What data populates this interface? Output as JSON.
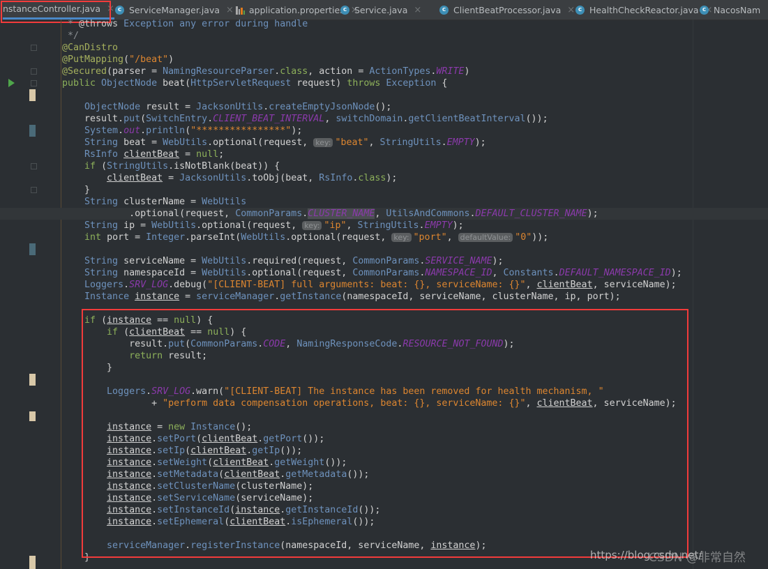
{
  "tabs": [
    {
      "label": "nstanceController.java",
      "icon": "none",
      "active": true
    },
    {
      "label": "ServiceManager.java",
      "icon": "class-icon"
    },
    {
      "label": "application.properties",
      "icon": "properties-icon"
    },
    {
      "label": "Service.java",
      "icon": "class-icon"
    },
    {
      "label": "ClientBeatProcessor.java",
      "icon": "class-icon"
    },
    {
      "label": "HealthCheckReactor.java",
      "icon": "class-icon"
    },
    {
      "label": "NacosNam",
      "icon": "class-icon"
    }
  ],
  "tab_close_glyph": "×",
  "class_icon_letter": "c",
  "colors": {
    "highlight_box": "#f23b3b",
    "keyword": "#8db05a",
    "type": "#6e92bd",
    "string": "#dd8630",
    "constant": "#8b3aab",
    "annotation": "#a6b15d",
    "background": "#2b2f33"
  },
  "code_lines": [
    {
      "indent": 0,
      "tokens": [
        [
          " * ",
          "c"
        ],
        [
          "@throws",
          "cd"
        ],
        [
          " Exception any error during handle",
          "t"
        ]
      ]
    },
    {
      "indent": 0,
      "tokens": [
        [
          " */",
          "c"
        ]
      ]
    },
    {
      "indent": 0,
      "tokens": [
        [
          "@CanDistro",
          "a"
        ]
      ]
    },
    {
      "indent": 0,
      "tokens": [
        [
          "@PutMapping",
          "a"
        ],
        [
          "(",
          ""
        ],
        [
          "\"/beat\"",
          "s"
        ],
        [
          ")",
          ""
        ]
      ]
    },
    {
      "indent": 0,
      "tokens": [
        [
          "@Secured",
          "a"
        ],
        [
          "(parser = ",
          ""
        ],
        [
          "NamingResourceParser",
          "t"
        ],
        [
          ".",
          ""
        ],
        [
          "class",
          "k"
        ],
        [
          ", action = ",
          ""
        ],
        [
          "ActionTypes",
          "t"
        ],
        [
          ".",
          ""
        ],
        [
          "WRITE",
          "p"
        ],
        [
          ")",
          ""
        ]
      ]
    },
    {
      "indent": 0,
      "tokens": [
        [
          "public ",
          "k"
        ],
        [
          "ObjectNode ",
          "t"
        ],
        [
          "beat(",
          ""
        ],
        [
          "HttpServletRequest ",
          "t"
        ],
        [
          "request) ",
          ""
        ],
        [
          "throws ",
          "k"
        ],
        [
          "Exception ",
          "t"
        ],
        [
          "{",
          ""
        ]
      ]
    },
    {
      "indent": 0,
      "tokens": []
    },
    {
      "indent": 4,
      "tokens": [
        [
          "ObjectNode ",
          "t"
        ],
        [
          "result = ",
          ""
        ],
        [
          "JacksonUtils",
          "t"
        ],
        [
          ".",
          ""
        ],
        [
          "createEmptyJsonNode",
          "t"
        ],
        [
          "();",
          ""
        ]
      ]
    },
    {
      "indent": 4,
      "tokens": [
        [
          "result.",
          ""
        ],
        [
          "put",
          "t"
        ],
        [
          "(",
          ""
        ],
        [
          "SwitchEntry",
          "t"
        ],
        [
          ".",
          ""
        ],
        [
          "CLIENT_BEAT_INTERVAL",
          "p"
        ],
        [
          ", ",
          ""
        ],
        [
          "switchDomain",
          "t"
        ],
        [
          ".",
          ""
        ],
        [
          "getClientBeatInterval",
          "t"
        ],
        [
          "());",
          ""
        ]
      ]
    },
    {
      "indent": 4,
      "tokens": [
        [
          "System",
          "t"
        ],
        [
          ".",
          ""
        ],
        [
          "out",
          "p"
        ],
        [
          ".",
          ""
        ],
        [
          "println",
          "t"
        ],
        [
          "(",
          ""
        ],
        [
          "\"****************\"",
          "s"
        ],
        [
          ");",
          ""
        ]
      ]
    },
    {
      "indent": 4,
      "tokens": [
        [
          "String ",
          "t"
        ],
        [
          "beat = ",
          ""
        ],
        [
          "WebUtils",
          "t"
        ],
        [
          ".optional(request, ",
          ""
        ],
        [
          "key:",
          "h"
        ],
        [
          "\"beat\"",
          "s"
        ],
        [
          ", ",
          ""
        ],
        [
          "StringUtils",
          "t"
        ],
        [
          ".",
          ""
        ],
        [
          "EMPTY",
          "p"
        ],
        [
          ");",
          ""
        ]
      ]
    },
    {
      "indent": 4,
      "tokens": [
        [
          "RsInfo ",
          "t"
        ],
        [
          "clientBeat",
          "u"
        ],
        [
          " = ",
          ""
        ],
        [
          "null",
          "k"
        ],
        [
          ";",
          ""
        ]
      ]
    },
    {
      "indent": 4,
      "tokens": [
        [
          "if ",
          "k"
        ],
        [
          "(",
          ""
        ],
        [
          "StringUtils",
          "t"
        ],
        [
          ".isNotBlank(beat)) {",
          ""
        ]
      ]
    },
    {
      "indent": 8,
      "tokens": [
        [
          "clientBeat",
          "u"
        ],
        [
          " = ",
          ""
        ],
        [
          "JacksonUtils",
          "t"
        ],
        [
          ".toObj(beat, ",
          ""
        ],
        [
          "RsInfo",
          "t"
        ],
        [
          ".",
          ""
        ],
        [
          "class",
          "k"
        ],
        [
          ");",
          ""
        ]
      ]
    },
    {
      "indent": 4,
      "tokens": [
        [
          "}",
          ""
        ]
      ]
    },
    {
      "indent": 4,
      "tokens": [
        [
          "String ",
          "t"
        ],
        [
          "clusterName = ",
          ""
        ],
        [
          "WebUtils",
          "t"
        ]
      ]
    },
    {
      "indent": 12,
      "tokens": [
        [
          ".optional(request, ",
          ""
        ],
        [
          "CommonParams",
          "t"
        ],
        [
          ".",
          ""
        ],
        [
          "CLUSTER_NAME",
          "p hl"
        ],
        [
          ", ",
          ""
        ],
        [
          "UtilsAndCommons",
          "t"
        ],
        [
          ".",
          ""
        ],
        [
          "DEFAULT_CLUSTER_NAME",
          "p"
        ],
        [
          ");",
          ""
        ]
      ]
    },
    {
      "indent": 4,
      "tokens": [
        [
          "String ",
          "t"
        ],
        [
          "ip = ",
          ""
        ],
        [
          "WebUtils",
          "t"
        ],
        [
          ".optional(request, ",
          ""
        ],
        [
          "key:",
          "h"
        ],
        [
          "\"ip\"",
          "s"
        ],
        [
          ", ",
          ""
        ],
        [
          "StringUtils",
          "t"
        ],
        [
          ".",
          ""
        ],
        [
          "EMPTY",
          "p"
        ],
        [
          ");",
          ""
        ]
      ]
    },
    {
      "indent": 4,
      "tokens": [
        [
          "int ",
          "k"
        ],
        [
          "port = ",
          ""
        ],
        [
          "Integer",
          "t"
        ],
        [
          ".parseInt(",
          ""
        ],
        [
          "WebUtils",
          "t"
        ],
        [
          ".optional(request, ",
          ""
        ],
        [
          "key:",
          "h"
        ],
        [
          "\"port\"",
          "s"
        ],
        [
          ", ",
          ""
        ],
        [
          "defaultValue:",
          "h"
        ],
        [
          "\"0\"",
          "s"
        ],
        [
          "));",
          ""
        ]
      ]
    },
    {
      "indent": 0,
      "tokens": []
    },
    {
      "indent": 4,
      "tokens": [
        [
          "String ",
          "t"
        ],
        [
          "serviceName = ",
          ""
        ],
        [
          "WebUtils",
          "t"
        ],
        [
          ".required(request, ",
          ""
        ],
        [
          "CommonParams",
          "t"
        ],
        [
          ".",
          ""
        ],
        [
          "SERVICE_NAME",
          "p"
        ],
        [
          ");",
          ""
        ]
      ]
    },
    {
      "indent": 4,
      "tokens": [
        [
          "String ",
          "t"
        ],
        [
          "namespaceId = ",
          ""
        ],
        [
          "WebUtils",
          "t"
        ],
        [
          ".optional(request, ",
          ""
        ],
        [
          "CommonParams",
          "t"
        ],
        [
          ".",
          ""
        ],
        [
          "NAMESPACE_ID",
          "p"
        ],
        [
          ", ",
          ""
        ],
        [
          "Constants",
          "t"
        ],
        [
          ".",
          ""
        ],
        [
          "DEFAULT_NAMESPACE_ID",
          "p"
        ],
        [
          ");",
          ""
        ]
      ]
    },
    {
      "indent": 4,
      "tokens": [
        [
          "Loggers",
          "t"
        ],
        [
          ".",
          ""
        ],
        [
          "SRV_LOG",
          "p"
        ],
        [
          ".debug(",
          ""
        ],
        [
          "\"[CLIENT-BEAT] full arguments: beat: {}, serviceName: {}\"",
          "s"
        ],
        [
          ", ",
          ""
        ],
        [
          "clientBeat",
          "u"
        ],
        [
          ", serviceName);",
          ""
        ]
      ]
    },
    {
      "indent": 4,
      "tokens": [
        [
          "Instance ",
          "t"
        ],
        [
          "instance",
          "u"
        ],
        [
          " = ",
          ""
        ],
        [
          "serviceManager",
          "t"
        ],
        [
          ".",
          ""
        ],
        [
          "getInstance",
          "t"
        ],
        [
          "(namespaceId, serviceName, clusterName, ip, port);",
          ""
        ]
      ]
    },
    {
      "indent": 0,
      "tokens": []
    },
    {
      "indent": 4,
      "tokens": [
        [
          "if ",
          "k"
        ],
        [
          "(",
          ""
        ],
        [
          "instance",
          "u"
        ],
        [
          " == ",
          ""
        ],
        [
          "null",
          "k"
        ],
        [
          ") {",
          ""
        ]
      ]
    },
    {
      "indent": 8,
      "tokens": [
        [
          "if ",
          "k"
        ],
        [
          "(",
          ""
        ],
        [
          "clientBeat",
          "u"
        ],
        [
          " == ",
          ""
        ],
        [
          "null",
          "k"
        ],
        [
          ") {",
          ""
        ]
      ]
    },
    {
      "indent": 12,
      "tokens": [
        [
          "result.",
          ""
        ],
        [
          "put",
          "t"
        ],
        [
          "(",
          ""
        ],
        [
          "CommonParams",
          "t"
        ],
        [
          ".",
          ""
        ],
        [
          "CODE",
          "p"
        ],
        [
          ", ",
          ""
        ],
        [
          "NamingResponseCode",
          "t"
        ],
        [
          ".",
          ""
        ],
        [
          "RESOURCE_NOT_FOUND",
          "p"
        ],
        [
          ");",
          ""
        ]
      ]
    },
    {
      "indent": 12,
      "tokens": [
        [
          "return ",
          "k"
        ],
        [
          "result;",
          ""
        ]
      ]
    },
    {
      "indent": 8,
      "tokens": [
        [
          "}",
          ""
        ]
      ]
    },
    {
      "indent": 0,
      "tokens": []
    },
    {
      "indent": 8,
      "tokens": [
        [
          "Loggers",
          "t"
        ],
        [
          ".",
          ""
        ],
        [
          "SRV_LOG",
          "p"
        ],
        [
          ".warn(",
          ""
        ],
        [
          "\"[CLIENT-BEAT] The instance has been removed for health mechanism, \"",
          "s"
        ]
      ]
    },
    {
      "indent": 16,
      "tokens": [
        [
          "+ ",
          ""
        ],
        [
          "\"perform data compensation operations, beat: {}, serviceName: {}\"",
          "s"
        ],
        [
          ", ",
          ""
        ],
        [
          "clientBeat",
          "u"
        ],
        [
          ", serviceName);",
          ""
        ]
      ]
    },
    {
      "indent": 0,
      "tokens": []
    },
    {
      "indent": 8,
      "tokens": [
        [
          "instance",
          "u"
        ],
        [
          " = ",
          ""
        ],
        [
          "new ",
          "k"
        ],
        [
          "Instance",
          "t"
        ],
        [
          "();",
          ""
        ]
      ]
    },
    {
      "indent": 8,
      "tokens": [
        [
          "instance",
          "u"
        ],
        [
          ".",
          ""
        ],
        [
          "setPort",
          "t"
        ],
        [
          "(",
          ""
        ],
        [
          "clientBeat",
          "u"
        ],
        [
          ".",
          ""
        ],
        [
          "getPort",
          "t"
        ],
        [
          "());",
          ""
        ]
      ]
    },
    {
      "indent": 8,
      "tokens": [
        [
          "instance",
          "u"
        ],
        [
          ".",
          ""
        ],
        [
          "setIp",
          "t"
        ],
        [
          "(",
          ""
        ],
        [
          "clientBeat",
          "u"
        ],
        [
          ".",
          ""
        ],
        [
          "getIp",
          "t"
        ],
        [
          "());",
          ""
        ]
      ]
    },
    {
      "indent": 8,
      "tokens": [
        [
          "instance",
          "u"
        ],
        [
          ".",
          ""
        ],
        [
          "setWeight",
          "t"
        ],
        [
          "(",
          ""
        ],
        [
          "clientBeat",
          "u"
        ],
        [
          ".",
          ""
        ],
        [
          "getWeight",
          "t"
        ],
        [
          "());",
          ""
        ]
      ]
    },
    {
      "indent": 8,
      "tokens": [
        [
          "instance",
          "u"
        ],
        [
          ".",
          ""
        ],
        [
          "setMetadata",
          "t"
        ],
        [
          "(",
          ""
        ],
        [
          "clientBeat",
          "u"
        ],
        [
          ".",
          ""
        ],
        [
          "getMetadata",
          "t"
        ],
        [
          "());",
          ""
        ]
      ]
    },
    {
      "indent": 8,
      "tokens": [
        [
          "instance",
          "u"
        ],
        [
          ".",
          ""
        ],
        [
          "setClusterName",
          "t"
        ],
        [
          "(clusterName);",
          ""
        ]
      ]
    },
    {
      "indent": 8,
      "tokens": [
        [
          "instance",
          "u"
        ],
        [
          ".",
          ""
        ],
        [
          "setServiceName",
          "t"
        ],
        [
          "(serviceName);",
          ""
        ]
      ]
    },
    {
      "indent": 8,
      "tokens": [
        [
          "instance",
          "u"
        ],
        [
          ".",
          ""
        ],
        [
          "setInstanceId",
          "t"
        ],
        [
          "(",
          ""
        ],
        [
          "instance",
          "u"
        ],
        [
          ".",
          ""
        ],
        [
          "getInstanceId",
          "t"
        ],
        [
          "());",
          ""
        ]
      ]
    },
    {
      "indent": 8,
      "tokens": [
        [
          "instance",
          "u"
        ],
        [
          ".",
          ""
        ],
        [
          "setEphemeral",
          "t"
        ],
        [
          "(",
          ""
        ],
        [
          "clientBeat",
          "u"
        ],
        [
          ".",
          ""
        ],
        [
          "isEphemeral",
          "t"
        ],
        [
          "());",
          ""
        ]
      ]
    },
    {
      "indent": 0,
      "tokens": []
    },
    {
      "indent": 8,
      "tokens": [
        [
          "serviceManager",
          "t"
        ],
        [
          ".",
          ""
        ],
        [
          "registerInstance",
          "t"
        ],
        [
          "(namespaceId, serviceName, ",
          ""
        ],
        [
          "instance",
          "u"
        ],
        [
          ");",
          ""
        ]
      ]
    },
    {
      "indent": 4,
      "tokens": [
        [
          "}",
          ""
        ]
      ]
    }
  ],
  "watermark": {
    "url": "https://blog.csdn.net/",
    "author": "CSDN @非常自然"
  }
}
